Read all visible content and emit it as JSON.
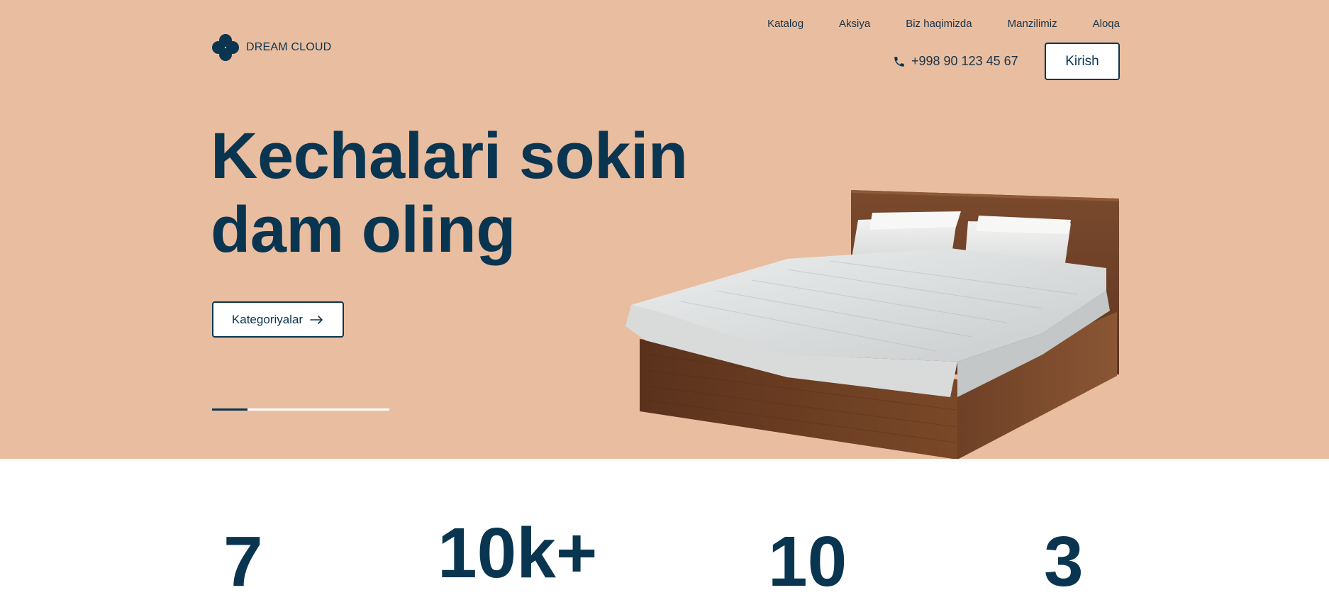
{
  "brand": {
    "name": "DREAM CLOUD",
    "logo_icon": "cloud-clover-icon"
  },
  "nav": {
    "items": [
      {
        "label": "Katalog"
      },
      {
        "label": "Aksiya"
      },
      {
        "label": "Biz haqimizda"
      },
      {
        "label": "Manzilimiz"
      },
      {
        "label": "Aloqa"
      }
    ]
  },
  "contact": {
    "phone": "+998 90 123 45 67",
    "phone_icon": "phone-icon"
  },
  "auth": {
    "login_label": "Kirish"
  },
  "hero": {
    "title_line1": "Kechalari sokin",
    "title_line2": "dam oling",
    "cta_label": "Kategoriyalar",
    "cta_icon": "arrow-right-icon",
    "slider_progress": 0.2,
    "background_color": "#e9bd9f",
    "image": "bed-image"
  },
  "stats": {
    "values": [
      "7",
      "10k+",
      "10",
      "3"
    ]
  },
  "colors": {
    "primary": "#0a3550",
    "accent_topline": "#7a4bd0"
  }
}
